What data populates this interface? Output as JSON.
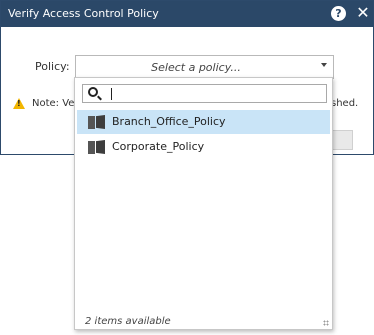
{
  "dialog": {
    "title": "Verify Access Control Policy",
    "help_glyph": "?",
    "close_glyph": "✕",
    "policy_label": "Policy:",
    "select_placeholder": "Select a policy...",
    "note_text": "Note: Veri",
    "note_suffix": "shed."
  },
  "dropdown": {
    "search_value": "",
    "options": [
      {
        "label": "Branch_Office_Policy",
        "selected": true
      },
      {
        "label": "Corporate_Policy",
        "selected": false
      }
    ],
    "status": "2 items available"
  },
  "icons": {
    "help": "help-icon",
    "close": "close-icon",
    "warning": "warning-icon",
    "search": "search-icon",
    "policy": "policy-icon",
    "chevron": "chevron-down-icon"
  },
  "colors": {
    "titlebar": "#2b4868",
    "selected_row": "#c9e4f7",
    "warning": "#f2b600"
  }
}
